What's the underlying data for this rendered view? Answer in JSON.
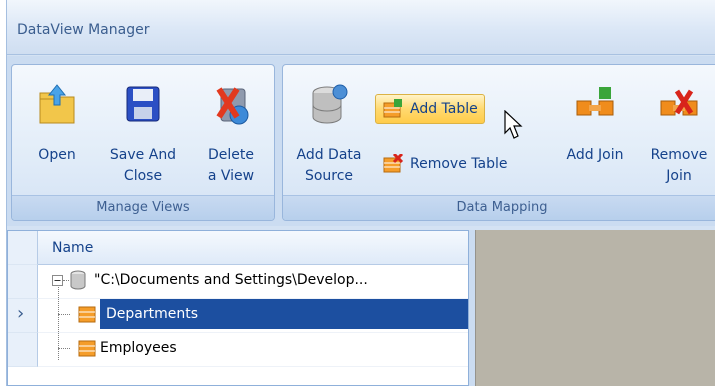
{
  "window": {
    "title": "DataView Manager"
  },
  "ribbon": {
    "manage_views": {
      "label": "Manage Views",
      "open": "Open",
      "save_close": "Save And\nClose",
      "delete_view": "Delete\na View"
    },
    "data_mapping": {
      "label": "Data Mapping",
      "add_data_source": "Add Data\nSource",
      "add_table": "Add Table",
      "remove_table": "Remove Table",
      "add_join": "Add Join",
      "remove_join": "Remove\nJoin"
    }
  },
  "tree": {
    "column_header": "Name",
    "root": "\"C:\\Documents and Settings\\Develop...",
    "items": [
      "Departments",
      "Employees"
    ],
    "selected_index": 0,
    "row_indicator": "›"
  },
  "colors": {
    "selection": "#1c4fa0",
    "ribbon_hover": "#ffd970",
    "right_panel": "#b8b4a8"
  }
}
